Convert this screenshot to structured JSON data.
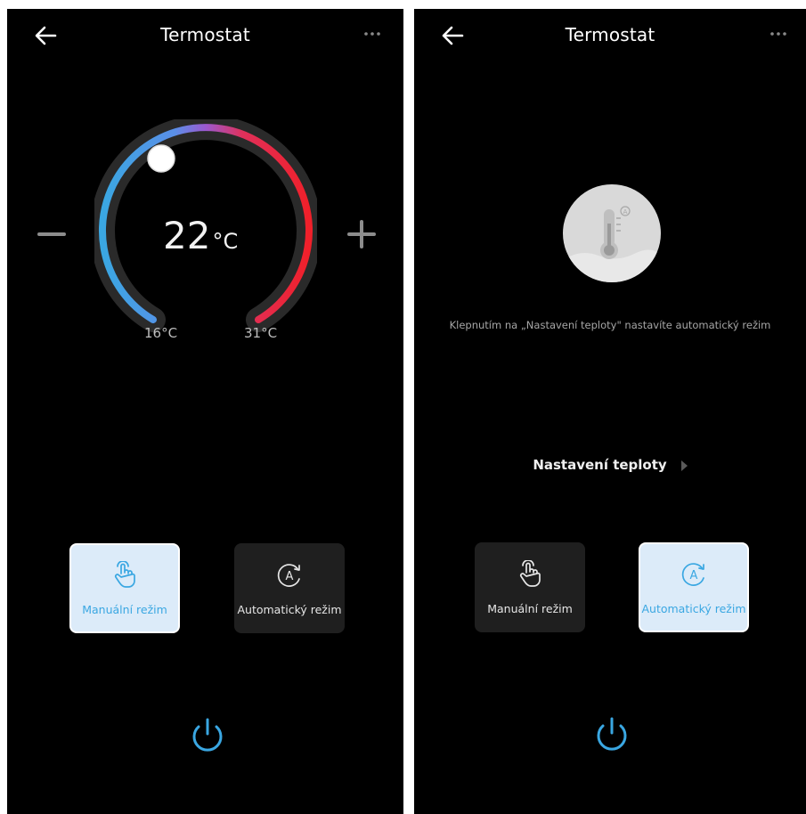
{
  "left_screen": {
    "header": {
      "title": "Termostat",
      "back_icon": "arrow-left-icon",
      "more_icon": "more-dots-icon"
    },
    "dial": {
      "current_temp": "22",
      "unit": "°C",
      "min_label": "16°C",
      "max_label": "31°C",
      "min_value": 16,
      "max_value": 31,
      "setpoint": 22
    },
    "controls": {
      "decrease_icon": "minus-icon",
      "increase_icon": "plus-icon"
    },
    "modes": [
      {
        "label": "Manuální režim",
        "icon": "hand-tap-icon",
        "active": true
      },
      {
        "label": "Automatický režim",
        "icon": "auto-mode-icon",
        "active": false
      }
    ],
    "power_icon": "power-icon"
  },
  "right_screen": {
    "header": {
      "title": "Termostat",
      "back_icon": "arrow-left-icon",
      "more_icon": "more-dots-icon"
    },
    "illustration_icon": "thermometer-auto-icon",
    "hint": "Klepnutím na „Nastavení teploty\" nastavíte automatický režim",
    "settings_link": "Nastavení teploty",
    "modes": [
      {
        "label": "Manuální režim",
        "icon": "hand-tap-icon",
        "active": false
      },
      {
        "label": "Automatický režim",
        "icon": "auto-mode-icon",
        "active": true
      }
    ],
    "power_icon": "power-icon"
  },
  "colors": {
    "background": "#000000",
    "accent_blue": "#3aa7e2",
    "active_card": "#dcebf9",
    "inactive_card": "#1f1f1f",
    "dial_cold": "#3aa7e2",
    "dial_mid": "#9b59d0",
    "dial_hot": "#f0202a"
  }
}
